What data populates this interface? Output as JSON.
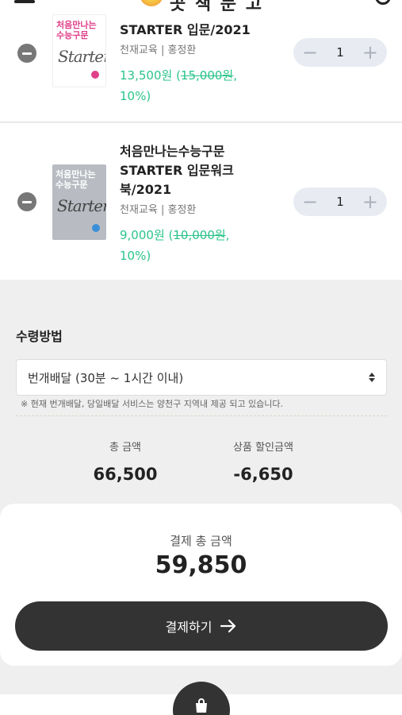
{
  "header": {
    "logo_text": "곳 책 문 고",
    "menu_icon": "hamburger-icon",
    "user_icon": "user-icon"
  },
  "cart": {
    "items": [
      {
        "cover_title": "처음만나는\n수능구문",
        "cover_script": "Starter",
        "title": "STARTER 입문/2021",
        "publisher": "천재교육 | 홍정환",
        "price": "13,500원",
        "price_original": "15,000원",
        "discount_paren_open": " (",
        "discount": ",",
        "discount_rate": "10%)",
        "quantity": "1",
        "minus": "−",
        "plus": "+"
      },
      {
        "cover_title": "처음만나는\n수능구문",
        "cover_script": "Starter",
        "title": "처음만나는수능구문 STARTER 입문워크북/2021",
        "publisher": "천재교육 | 홍정환",
        "price": "9,000원",
        "price_original": "10,000원",
        "discount_paren_open": " (",
        "discount": ",",
        "discount_rate": "10%)",
        "quantity": "1",
        "minus": "−",
        "plus": "+"
      }
    ]
  },
  "receive": {
    "title": "수령방법",
    "selected": "번개배달 (30분 ~ 1시간 이내)",
    "notice": "※ 현재 번개배달, 당일배달 서비스는 양천구 지역내 제공 되고 있습니다."
  },
  "summary": {
    "total_label": "총 금액",
    "total_value": "66,500",
    "discount_label": "상품 할인금액",
    "discount_value": "-6,650"
  },
  "payment": {
    "label": "결제 총 금액",
    "amount": "59,850",
    "button_label": "결제하기"
  },
  "colors": {
    "accent_green": "#2bc48a",
    "button_dark": "#333333"
  }
}
